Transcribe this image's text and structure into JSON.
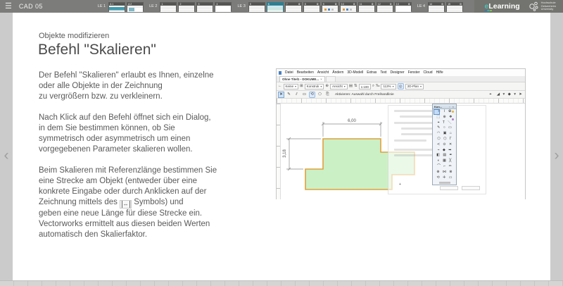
{
  "icons": {
    "hamburger": "☰",
    "gear": "⚙",
    "chevron_left": "‹",
    "chevron_right": "›",
    "close": "×",
    "caret": "▾",
    "ref_length_arrow": "↔",
    "back_arrow": "←",
    "grid": "⊞",
    "plus": "⊕",
    "doc": "▤",
    "swap": "⇅",
    "magnify": "⌕",
    "percent": "‰",
    "target": "◎",
    "select_arrow": "➤",
    "pen": "✎",
    "double_line": "⫽",
    "rect": "▭",
    "lasso": "⟲",
    "poly": "⬠",
    "copy": "⎘",
    "snap_target": "⌖",
    "snap_angle": "◢",
    "snap_point": "◆",
    "pin": "▫",
    "cursor": "➤"
  },
  "topbar": {
    "title": "CAD 05",
    "group_labels": [
      "LE 1",
      "LE 2",
      "LE 3",
      "LE 4"
    ],
    "thumbs": [
      {
        "id": "A 1"
      },
      {
        "id": "A 2"
      },
      {
        "id": "1"
      },
      {
        "id": "2"
      },
      {
        "id": "3"
      },
      {
        "id": "4"
      },
      {
        "id": "5"
      },
      {
        "id": "6"
      },
      {
        "id": "7"
      },
      {
        "id": "8"
      },
      {
        "id": "9"
      },
      {
        "id": "10"
      },
      {
        "id": "11"
      },
      {
        "id": "12"
      },
      {
        "id": "13"
      },
      {
        "id": "14"
      },
      {
        "id": "15"
      }
    ],
    "elearning_logo": {
      "e": "e",
      "rest": "Learning"
    },
    "university_logo": {
      "line1": "Hochschule",
      "line2": "Geisenheim",
      "line3": "University"
    }
  },
  "slide": {
    "kicker": "Objekte modifizieren",
    "title": "Befehl \"Skalieren\"",
    "p1": "Der Befehl \"Skalieren\" erlaubt es Ihnen, einzelne\noder alle Objekte in der Zeichnung\nzu vergrößern bzw. zu verkleinern.",
    "p2": "Nach Klick auf den Befehl öffnet sich ein Dialog,\nin dem Sie bestimmen können, ob Sie\nsymmetrisch oder asymmetrisch um einen\nvorgegebenen Parameter skalieren wollen.",
    "p3_part1": "Beim Skalieren mit Referenzlänge bestimmen Sie\neine Strecke am Objekt (entweder über eine\nkonkrete Eingabe oder durch Anklicken auf der\nZeichnung mittels des ",
    "p3_part2": " Symbols) und\ngeben eine neue Länge für diese Strecke ein.\nVectorworks ermittelt aus diesen beiden Werten\nautomatisch den Skalierfaktor."
  },
  "cad": {
    "menu": [
      "Datei",
      "Bearbeiten",
      "Ansicht",
      "Ändern",
      "3D-Modell",
      "Extras",
      "Text",
      "Designer",
      "Fenster",
      "Cloud",
      "Hilfe"
    ],
    "tab": "Ohne Titel1 - DOKUME...",
    "toolbar": {
      "class_value": "Keine",
      "layer_value": "Konstruk",
      "view_value": "Ansicht",
      "scale_value": "1:100",
      "zoom_value": "113%",
      "plan_value": "2D-Plan",
      "status": "Aktivieren: Auswahl durch Freihandlinie"
    },
    "palette": {
      "title": "Kon...",
      "rows": [
        "➤ ⌇ ✿",
        "⬚ ⊕ ❖",
        "⌖ T ╲",
        "✎ ○ ▭",
        "◠ ▣ ⌂",
        "⬠ ⬡ Γ",
        "≺ ⊙ ✕",
        "⌁ ◆ ➥",
        "◧ ▤ ✒",
        "◐ ▦ ╳",
        "⌒ ⌐ ✏",
        "⊕ ⋈ ⊗",
        "⟲ ✛ ▭"
      ]
    },
    "canvas": {
      "dim_horizontal": "6,00",
      "dim_vertical": "3,18",
      "shape_fill": "#cbf0c6",
      "shape_stroke": "#e0a03e",
      "dim_color": "#808080"
    }
  }
}
